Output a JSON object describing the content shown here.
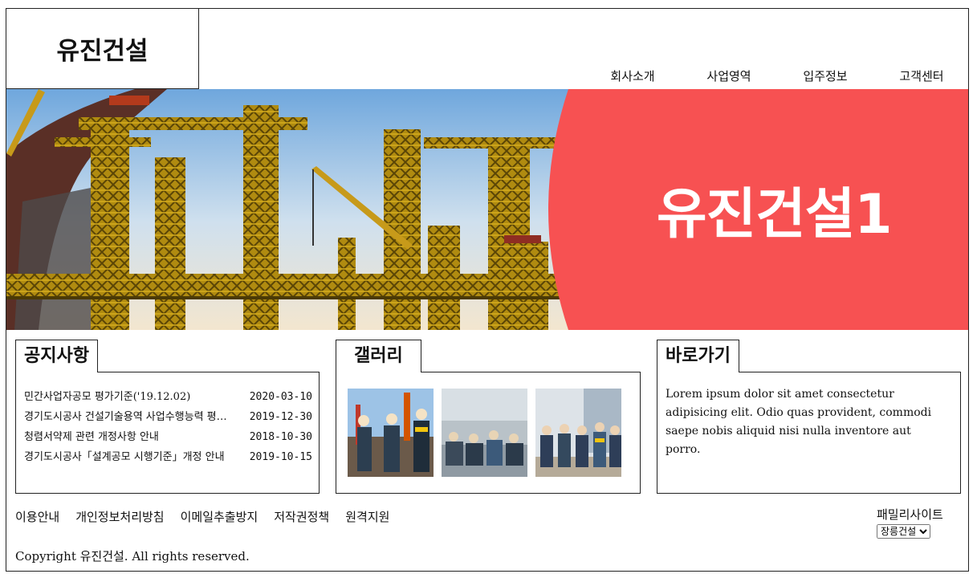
{
  "header": {
    "logo": "유진건설",
    "nav": [
      "회사소개",
      "사업영역",
      "입주정보",
      "고객센터"
    ]
  },
  "hero": {
    "title": "유진건설1",
    "accent_color": "#f75152"
  },
  "notice": {
    "tab": "공지사항",
    "items": [
      {
        "title": "민간사업자공모 평가기준('19.12.02)",
        "date": "2020-03-10"
      },
      {
        "title": "경기도시공사 건설기술용역 사업수행능력 평가기준",
        "date": "2019-12-30"
      },
      {
        "title": "청렴서약제 관련 개정사항 안내",
        "date": "2018-10-30"
      },
      {
        "title": "경기도시공사「설계공모 시행기준」개정 안내",
        "date": "2019-10-15"
      }
    ]
  },
  "gallery": {
    "tab": "갤러리",
    "images": [
      "construction-workers-photo",
      "workers-resting-photo",
      "workers-group-photo"
    ]
  },
  "shortcut": {
    "tab": "바로가기",
    "text": "Lorem ipsum dolor sit amet consectetur adipisicing elit. Odio quas provident, commodi saepe nobis aliquid nisi nulla inventore aut porro."
  },
  "footer": {
    "links": [
      "이용안내",
      "개인정보처리방침",
      "이메일추출방지",
      "저작권정책",
      "원격지원"
    ],
    "family_label": "패밀리사이트",
    "family_selected": "장릉건설",
    "copyright": "Copyright 유진건설. All rights reserved."
  }
}
